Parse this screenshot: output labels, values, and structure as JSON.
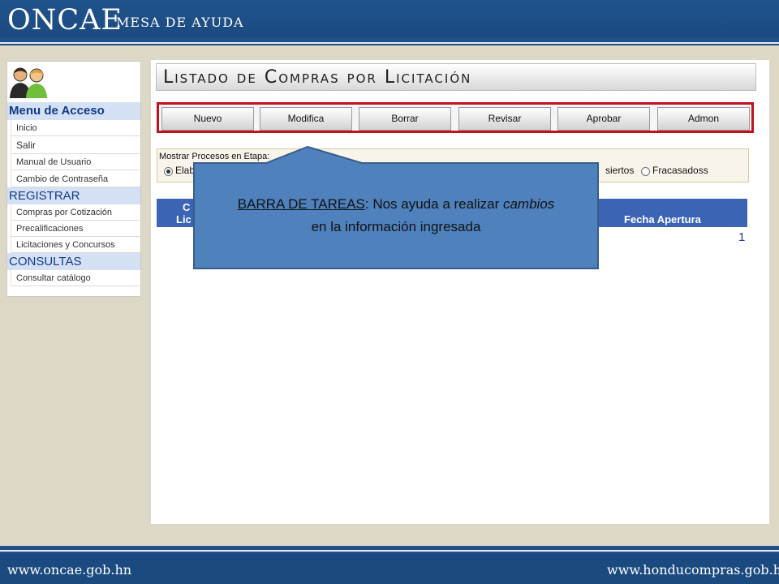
{
  "header": {
    "brand": "ONCAE",
    "subtitle": "MESA DE AYUDA"
  },
  "footer": {
    "left_url": "www.oncae.gob.hn",
    "right_url": "www.honducompras.gob.hn"
  },
  "sidebar": {
    "menu_title": "Menu de Acceso",
    "menu_items": [
      {
        "label": "Inicio"
      },
      {
        "label": "Salir"
      },
      {
        "label": "Manual de Usuario"
      },
      {
        "label": "Cambio de Contraseña"
      }
    ],
    "registrar_title": "REGISTRAR",
    "registrar_items": [
      {
        "label": "Compras por Cotización"
      },
      {
        "label": "Precalificaciones"
      },
      {
        "label": "Licitaciones y Concursos"
      }
    ],
    "consultas_title": "CONSULTAS",
    "consultas_items": [
      {
        "label": "Consultar catálogo"
      }
    ]
  },
  "main": {
    "title": "Listado de Compras por Licitación",
    "toolbar": [
      {
        "label": "Nuevo"
      },
      {
        "label": "Modifica"
      },
      {
        "label": "Borrar"
      },
      {
        "label": "Revisar"
      },
      {
        "label": "Aprobar"
      },
      {
        "label": "Admon"
      }
    ],
    "filter": {
      "label": "Mostrar Procesos en Etapa:",
      "visible_option_left": "Elab",
      "visible_option_desierto": "siertos",
      "visible_option_fracasados": "Fracasadoss",
      "selected": "Elab"
    },
    "table": {
      "col1_line1": "C",
      "col1_line2": "Lic",
      "col_fecha": "Fecha Apertura"
    },
    "pagination": {
      "page": "1"
    }
  },
  "callout": {
    "title": "BARRA DE TAREAS",
    "text_mid": ": Nos ayuda a realizar ",
    "emphasis": "cambios",
    "text_line2": "en la información ingresada",
    "fill_color": "#4f81bd"
  }
}
